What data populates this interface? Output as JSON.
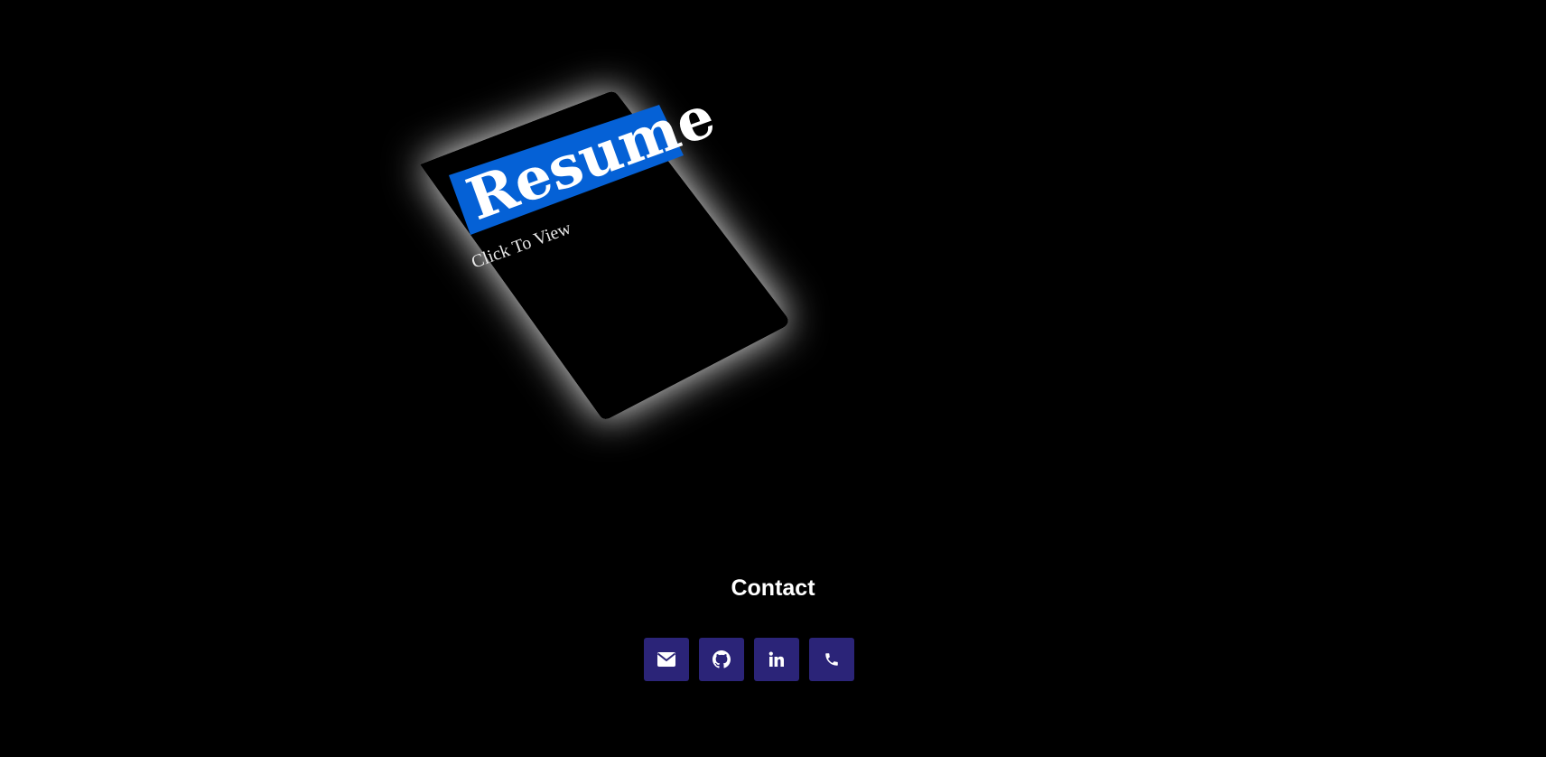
{
  "resume": {
    "title": "Resume",
    "subtitle": "Click To View"
  },
  "contact": {
    "heading": "Contact",
    "buttons": [
      {
        "icon": "envelope-icon",
        "label": "Email"
      },
      {
        "icon": "github-icon",
        "label": "GitHub"
      },
      {
        "icon": "linkedin-icon",
        "label": "LinkedIn"
      },
      {
        "icon": "phone-icon",
        "label": "Phone"
      }
    ]
  },
  "colors": {
    "background": "#000000",
    "resume_title_bg": "#0561d6",
    "button_bg": "#2b2478",
    "text": "#ffffff"
  }
}
